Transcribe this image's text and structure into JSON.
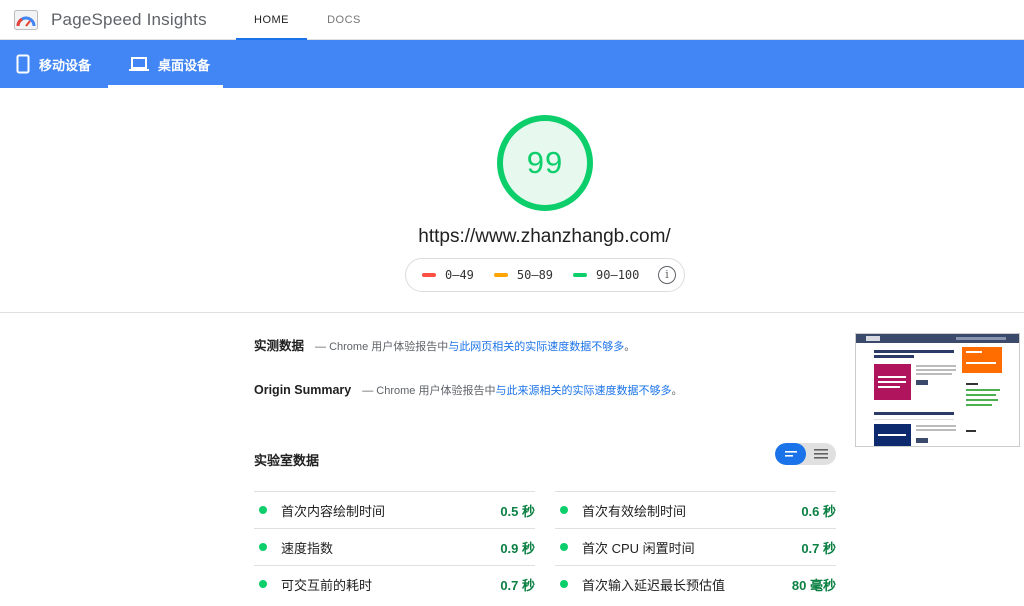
{
  "header": {
    "app_title": "PageSpeed Insights",
    "tabs": [
      {
        "label": "HOME"
      },
      {
        "label": "DOCS"
      }
    ]
  },
  "devices": [
    {
      "label": "移动设备",
      "icon": "phone-icon"
    },
    {
      "label": "桌面设备",
      "icon": "laptop-icon"
    }
  ],
  "score": {
    "value": "99",
    "url": "https://www.zhanzhangb.com/",
    "color": "#0cce6b"
  },
  "legend": [
    {
      "range": "0–49",
      "color": "#ff4e42"
    },
    {
      "range": "50–89",
      "color": "#ffa400"
    },
    {
      "range": "90–100",
      "color": "#0cce6b"
    }
  ],
  "field_data": {
    "title": "实测数据",
    "desc_prefix": "— Chrome 用户体验报告中",
    "desc_link": "与此网页相关的实际速度数据不够多",
    "desc_suffix": "。"
  },
  "origin_summary": {
    "title": "Origin Summary",
    "desc_prefix": "— Chrome 用户体验报告中",
    "desc_link": "与此来源相关的实际速度数据不够多",
    "desc_suffix": "。"
  },
  "lab_data": {
    "title": "实验室数据",
    "metrics": [
      {
        "name": "首次内容绘制时间",
        "value": "0.5 秒"
      },
      {
        "name": "首次有效绘制时间",
        "value": "0.6 秒"
      },
      {
        "name": "速度指数",
        "value": "0.9 秒"
      },
      {
        "name": "首次 CPU 闲置时间",
        "value": "0.7 秒"
      },
      {
        "name": "可交互前的耗时",
        "value": "0.7 秒"
      },
      {
        "name": "首次输入延迟最长预估值",
        "value": "80 毫秒"
      }
    ]
  }
}
